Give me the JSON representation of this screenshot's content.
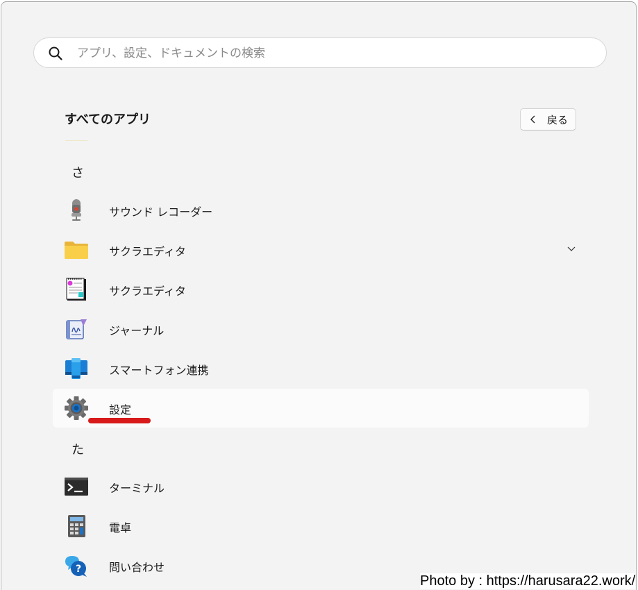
{
  "search": {
    "placeholder": "アプリ、設定、ドキュメントの検索",
    "icon": "search-icon"
  },
  "header": {
    "title": "すべてのアプリ",
    "back_label": "戻る"
  },
  "groups": [
    {
      "letter": "さ"
    },
    {
      "letter": "た"
    }
  ],
  "apps": [
    {
      "label": "サウンド レコーダー",
      "icon": "microphone-icon"
    },
    {
      "label": "サクラエディタ",
      "icon": "folder-icon",
      "expandable": true
    },
    {
      "label": "サクラエディタ",
      "icon": "notepad-icon"
    },
    {
      "label": "ジャーナル",
      "icon": "journal-icon"
    },
    {
      "label": "スマートフォン連携",
      "icon": "phone-link-icon"
    },
    {
      "label": "設定",
      "icon": "gear-icon",
      "highlighted": true
    },
    {
      "label": "ターミナル",
      "icon": "terminal-icon"
    },
    {
      "label": "電卓",
      "icon": "calculator-icon"
    },
    {
      "label": "問い合わせ",
      "icon": "help-icon"
    }
  ],
  "annotation": {
    "underline_color": "#d81a1a"
  },
  "credit": {
    "text": "Photo by : https://harusara22.work/"
  }
}
